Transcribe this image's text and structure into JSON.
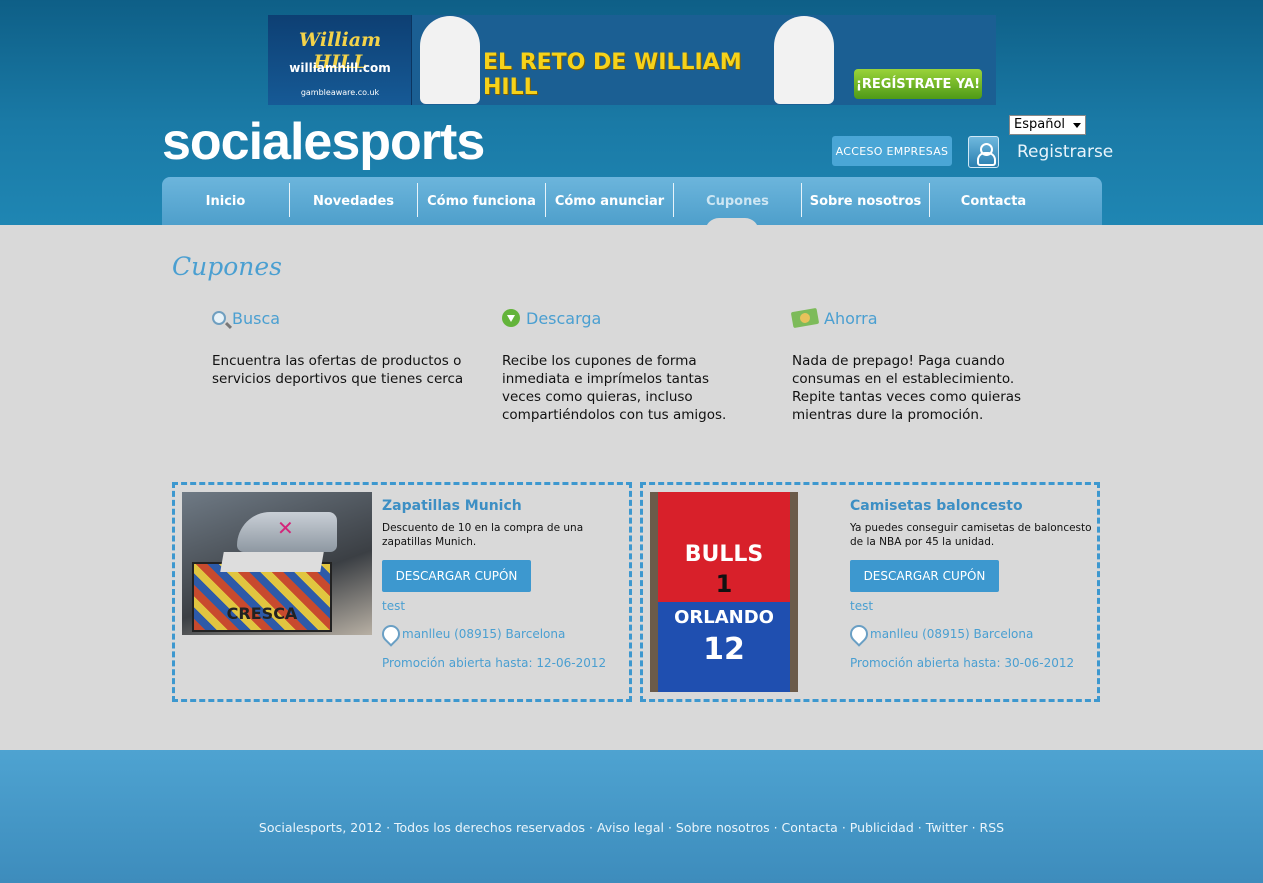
{
  "banner": {
    "brand": "William HILL",
    "url": "williamhill.com",
    "gamble": "gambleaware.co.uk",
    "title": "EL RETO DE WILLIAM HILL",
    "cta": "¡REGÍSTRATE YA!"
  },
  "header": {
    "logo": "socialesports",
    "language": "Español",
    "empresas_button": "ACCESO EMPRESAS",
    "register_link": "Registrarse"
  },
  "nav": {
    "items": [
      {
        "label": "Inicio"
      },
      {
        "label": "Novedades"
      },
      {
        "label": "Cómo funciona"
      },
      {
        "label": "Cómo anunciar"
      },
      {
        "label": "Cupones"
      },
      {
        "label": "Sobre nosotros"
      },
      {
        "label": "Contacta"
      }
    ]
  },
  "main": {
    "title": "Cupones",
    "features": [
      {
        "title": "Busca",
        "icon": "search-icon",
        "desc": "Encuentra las ofertas de productos o servicios deportivos que tienes cerca"
      },
      {
        "title": "Descarga",
        "icon": "download-icon",
        "desc": "Recibe los cupones de forma inmediata e imprímelos tantas veces como quieras, incluso compartiéndolos con tus amigos."
      },
      {
        "title": "Ahorra",
        "icon": "money-icon",
        "desc": "Nada de prepago! Paga cuando consumas en el establecimiento. Repite tantas veces como quieras mientras dure la promoción."
      }
    ],
    "coupons": [
      {
        "title": "Zapatillas Munich",
        "desc": "Descuento de 10  en la compra de una zapatillas Munich.",
        "button": "DESCARGAR CUPÓN",
        "tag": "test",
        "location": "manlleu (08915) Barcelona",
        "date": "Promoción abierta hasta: 12-06-2012",
        "image_text": "CRESCA"
      },
      {
        "title": "Camisetas baloncesto",
        "desc": "Ya puedes conseguir camisetas de baloncesto de la NBA por 45 la unidad.",
        "button": "DESCARGAR CUPÓN",
        "tag": "test",
        "location": "manlleu (08915) Barcelona",
        "date": "Promoción abierta hasta: 30-06-2012",
        "image_text_top": "BULLS",
        "image_num_top": "1",
        "image_text_bottom": "ORLANDO",
        "image_num_bottom": "12"
      }
    ]
  },
  "footer": {
    "copyright": "Socialesports, 2012",
    "links": [
      "Todos los derechos reservados",
      "Aviso legal",
      "Sobre nosotros",
      "Contacta",
      "Publicidad",
      "Twitter",
      "RSS"
    ]
  }
}
